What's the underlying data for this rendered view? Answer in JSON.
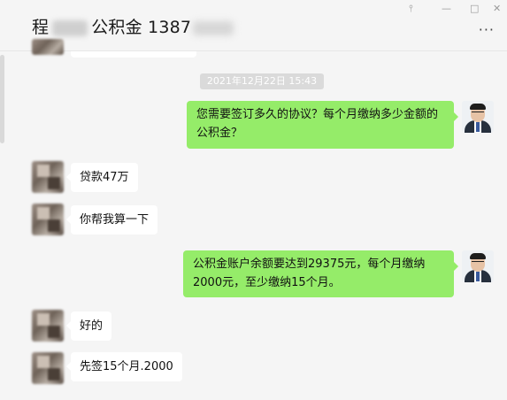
{
  "window": {
    "title_prefix": "程",
    "title_suffix": "公积金 1387",
    "pin_icon": "pin-icon",
    "minimize_icon": "minimize-icon",
    "maximize_icon": "maximize-icon",
    "close_icon": "close-icon",
    "more_icon": "more-dots-icon"
  },
  "chat": {
    "timestamp": "2021年12月22日 15:43",
    "messages": [
      {
        "side": "out",
        "text": "您需要签订多久的协议？每个月缴纳多少金额的公积金？"
      },
      {
        "side": "in",
        "text": "贷款47万"
      },
      {
        "side": "in",
        "text": "你帮我算一下"
      },
      {
        "side": "out",
        "text": "公积金账户余额要达到29375元，每个月缴纳2000元，至少缴纳15个月。"
      },
      {
        "side": "in",
        "text": "好的"
      },
      {
        "side": "in",
        "text": "先签15个月.2000"
      }
    ]
  },
  "colors": {
    "outgoing_bubble": "#95ec69",
    "incoming_bubble": "#ffffff",
    "background": "#f5f5f5",
    "timestamp_bg": "#dadada"
  }
}
